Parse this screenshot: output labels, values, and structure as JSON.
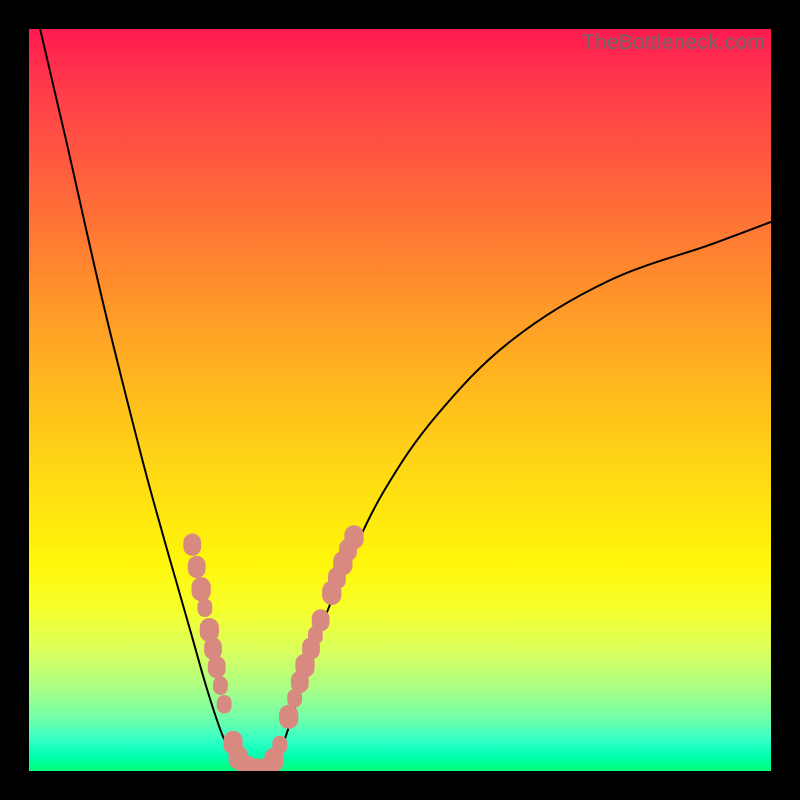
{
  "watermark": "TheBottleneck.com",
  "colors": {
    "frame": "#000000",
    "marker": "#d98a80",
    "curve": "#000000"
  },
  "chart_data": {
    "type": "line",
    "title": "",
    "xlabel": "",
    "ylabel": "",
    "xlim": [
      0,
      100
    ],
    "ylim": [
      0,
      100
    ],
    "series": [
      {
        "name": "left-branch",
        "x": [
          1.5,
          5,
          10,
          15,
          18,
          20,
          22,
          24,
          26,
          27.5,
          29
        ],
        "y": [
          100,
          85,
          63,
          43,
          32,
          25,
          18,
          11,
          5,
          2,
          0.5
        ]
      },
      {
        "name": "right-branch",
        "x": [
          32.5,
          34,
          36,
          38,
          40,
          43,
          48,
          55,
          65,
          78,
          92,
          100
        ],
        "y": [
          0.5,
          3,
          9,
          15,
          21,
          28,
          38,
          48,
          58,
          66,
          71,
          74
        ]
      },
      {
        "name": "floor",
        "x": [
          29,
          30,
          31,
          32.5
        ],
        "y": [
          0.5,
          0,
          0,
          0.5
        ]
      }
    ],
    "markers": [
      {
        "x": 22.0,
        "y": 30.5,
        "r": 1.2
      },
      {
        "x": 22.6,
        "y": 27.5,
        "r": 1.2
      },
      {
        "x": 23.2,
        "y": 24.5,
        "r": 1.3
      },
      {
        "x": 23.7,
        "y": 22.0,
        "r": 1.0
      },
      {
        "x": 24.3,
        "y": 19.0,
        "r": 1.3
      },
      {
        "x": 24.8,
        "y": 16.5,
        "r": 1.2
      },
      {
        "x": 25.3,
        "y": 14.0,
        "r": 1.2
      },
      {
        "x": 25.8,
        "y": 11.5,
        "r": 1.0
      },
      {
        "x": 26.3,
        "y": 9.0,
        "r": 1.0
      },
      {
        "x": 27.5,
        "y": 3.8,
        "r": 1.3
      },
      {
        "x": 28.2,
        "y": 1.8,
        "r": 1.3
      },
      {
        "x": 29.3,
        "y": 0.5,
        "r": 1.3
      },
      {
        "x": 30.6,
        "y": 0.1,
        "r": 1.3
      },
      {
        "x": 32.0,
        "y": 0.3,
        "r": 1.2
      },
      {
        "x": 33.0,
        "y": 1.5,
        "r": 1.3
      },
      {
        "x": 33.8,
        "y": 3.5,
        "r": 1.0
      },
      {
        "x": 35.0,
        "y": 7.3,
        "r": 1.3
      },
      {
        "x": 35.8,
        "y": 9.8,
        "r": 1.0
      },
      {
        "x": 36.5,
        "y": 12.0,
        "r": 1.2
      },
      {
        "x": 37.2,
        "y": 14.2,
        "r": 1.3
      },
      {
        "x": 38.0,
        "y": 16.5,
        "r": 1.2
      },
      {
        "x": 38.6,
        "y": 18.3,
        "r": 1.0
      },
      {
        "x": 39.3,
        "y": 20.3,
        "r": 1.2
      },
      {
        "x": 40.8,
        "y": 24.0,
        "r": 1.3
      },
      {
        "x": 41.5,
        "y": 26.0,
        "r": 1.2
      },
      {
        "x": 42.3,
        "y": 28.0,
        "r": 1.3
      },
      {
        "x": 43.0,
        "y": 29.8,
        "r": 1.2
      },
      {
        "x": 43.8,
        "y": 31.5,
        "r": 1.3
      }
    ]
  }
}
